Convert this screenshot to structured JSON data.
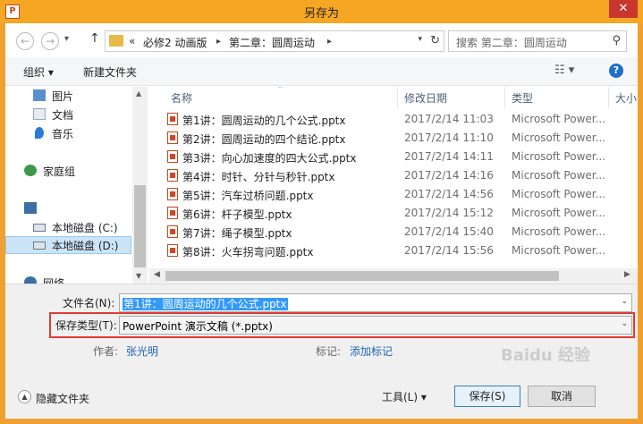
{
  "window": {
    "title": "另存为",
    "app_icon_letter": "P",
    "close_glyph": "✕"
  },
  "nav": {
    "back": "←",
    "forward": "→",
    "recent": "▾",
    "up": "↑"
  },
  "address": {
    "prefix": "«",
    "segments": [
      "必修2 动画版",
      "第二章：圆周运动"
    ],
    "separator": "▸",
    "dropdown": "▾",
    "refresh": "↻"
  },
  "search": {
    "placeholder": "搜索 第二章：圆周运动",
    "icon": "⚲"
  },
  "toolbar": {
    "organize": "组织 ▾",
    "new_folder": "新建文件夹",
    "view": "☷ ▾",
    "help": "?"
  },
  "sidebar": {
    "items": [
      {
        "label": "图片",
        "icon": "pictures-icon",
        "color": "#5a8fd0"
      },
      {
        "label": "文档",
        "icon": "documents-icon",
        "color": "#9aa7b5"
      },
      {
        "label": "音乐",
        "icon": "music-icon",
        "color": "#2b7bd6"
      },
      {
        "label": "家庭组",
        "icon": "homegroup-icon",
        "color": "#3a9a4a"
      },
      {
        "label": "",
        "icon": "computer-icon",
        "color": "#3a6ea5"
      },
      {
        "label": "本地磁盘 (C:)",
        "icon": "drive-c-icon",
        "color": "#6a7a8a"
      },
      {
        "label": "本地磁盘 (D:)",
        "icon": "drive-d-icon",
        "color": "#6a7a8a"
      },
      {
        "label": "网络",
        "icon": "network-icon",
        "color": "#3a6ea5"
      }
    ]
  },
  "filelist": {
    "columns": {
      "name": "名称",
      "date": "修改日期",
      "type": "类型",
      "size": "大小"
    },
    "sort_indicator": "^",
    "rows": [
      {
        "name": "第1讲：圆周运动的几个公式.pptx",
        "date": "2017/2/14 11:03",
        "type": "Microsoft Power..."
      },
      {
        "name": "第2讲：圆周运动的四个结论.pptx",
        "date": "2017/2/14 11:10",
        "type": "Microsoft Power..."
      },
      {
        "name": "第3讲：向心加速度的四大公式.pptx",
        "date": "2017/2/14 14:11",
        "type": "Microsoft Power..."
      },
      {
        "name": "第4讲：时针、分针与秒针.pptx",
        "date": "2017/2/14 14:16",
        "type": "Microsoft Power..."
      },
      {
        "name": "第5讲：汽车过桥问题.pptx",
        "date": "2017/2/14 14:56",
        "type": "Microsoft Power..."
      },
      {
        "name": "第6讲：杆子模型.pptx",
        "date": "2017/2/14 15:12",
        "type": "Microsoft Power..."
      },
      {
        "name": "第7讲：绳子模型.pptx",
        "date": "2017/2/14 15:40",
        "type": "Microsoft Power..."
      },
      {
        "name": "第8讲：火车拐弯问题.pptx",
        "date": "2017/2/14 15:56",
        "type": "Microsoft Power..."
      }
    ]
  },
  "form": {
    "filename_label": "文件名(N):",
    "filename_value": "第1讲：圆周运动的几个公式.pptx",
    "filetype_label": "保存类型(T):",
    "filetype_value": "PowerPoint 演示文稿 (*.pptx)",
    "author_label": "作者:",
    "author_value": "张光明",
    "tags_label": "标记:",
    "tags_value": "添加标记",
    "hide_folders": "隐藏文件夹",
    "tools": "工具(L)  ▾",
    "save": "保存(S)",
    "cancel": "取消",
    "dropdown": "⌄"
  },
  "watermark": "Baidu 经验"
}
